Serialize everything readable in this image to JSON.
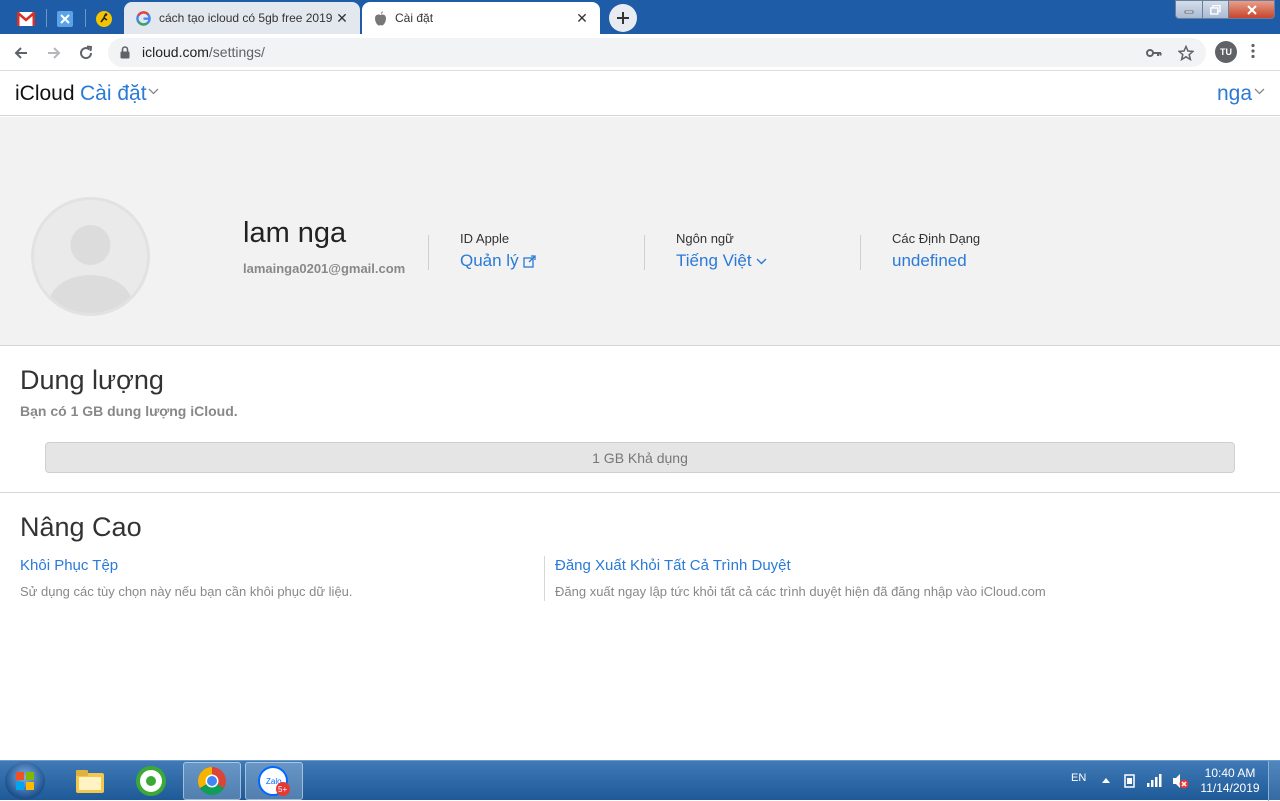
{
  "browser": {
    "tabs": [
      {
        "title": "cách tạo icloud có 5gb free 2019",
        "active": false
      },
      {
        "title": "Cài đặt",
        "active": true
      }
    ],
    "url_host": "icloud.com",
    "url_path": "/settings/",
    "profile_initials": "TU"
  },
  "header": {
    "brand": "iCloud",
    "app_name": "Cài đặt",
    "user_name": "nga"
  },
  "profile": {
    "name": "lam nga",
    "email": "lamainga0201@gmail.com",
    "apple_id_label": "ID Apple",
    "apple_id_link": "Quản lý",
    "language_label": "Ngôn ngữ",
    "language_value": "Tiếng Việt",
    "formats_label": "Các Định Dạng",
    "formats_value": "undefined"
  },
  "storage": {
    "title": "Dung lượng",
    "subtitle": "Bạn có 1 GB dung lượng iCloud.",
    "bar_label": "1 GB Khả dụng"
  },
  "advanced": {
    "title": "Nâng Cao",
    "restore_link": "Khôi Phục Tệp",
    "restore_desc": "Sử dụng các tùy chọn này nếu bạn cần khôi phục dữ liệu.",
    "signout_link": "Đăng Xuất Khỏi Tất Cả Trình Duyệt",
    "signout_desc": "Đăng xuất ngay lập tức khỏi tất cả các trình duyệt hiện đã đăng nhập vào iCloud.com"
  },
  "taskbar": {
    "language": "EN",
    "time": "10:40 AM",
    "date": "11/14/2019",
    "zalo_badge": "5+",
    "zalo_label": "Zalo"
  },
  "colors": {
    "accent": "#2a7ad6",
    "tabstrip": "#1e5ca8"
  }
}
